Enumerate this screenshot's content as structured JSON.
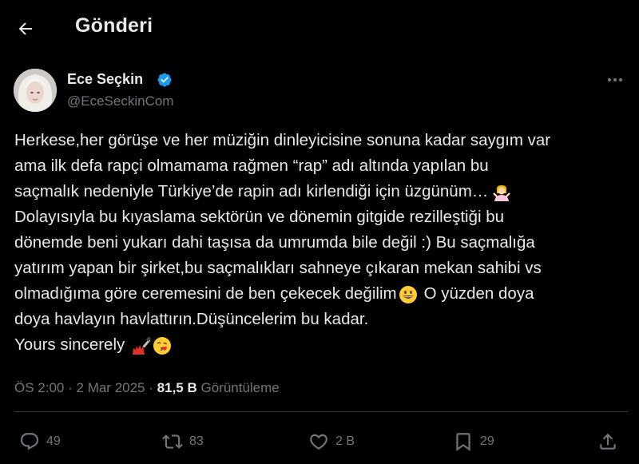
{
  "header": {
    "title": "Gönderi"
  },
  "author": {
    "name": "Ece Seçkin",
    "handle": "@EceSeckinCom"
  },
  "tweet": {
    "lines": [
      "Herkese,her görüşe ve her müziğin dinleyicisine sonuna kadar saygım var",
      "ama ilk defa rapçi olmamama rağmen “rap” adı altında yapılan bu",
      "saçmalık nedeniyle Türkiye’de rapin adı kirlendiği için üzgünüm…",
      "Dolayısıyla bu kıyaslama sektörün ve dönemin gitgide rezilleştiği bu",
      "dönemde beni yukarı dahi taşısa da umrumda bile değil :) Bu saçmalığa",
      "yatırım yapan bir şirket,bu saçmalıkları sahneye çıkaran mekan sahibi vs",
      "olmadığıma göre ceremesini de ben çekecek değilim",
      "O yüzden doya",
      "doya havlayın havlattırın.Düşüncelerim bu kadar.",
      "Yours sincerely"
    ]
  },
  "meta": {
    "time": "ÖS 2:00",
    "separator": "·",
    "date": "2 Mar 2025",
    "views_count": "81,5 B",
    "views_label": "Görüntüleme"
  },
  "actions": {
    "replies": "49",
    "reposts": "83",
    "likes": "2 B",
    "bookmarks": "29"
  },
  "colors": {
    "background": "#000000",
    "text": "#e7e9ea",
    "muted": "#71767b",
    "divider": "#2f3336",
    "verified": "#1d9bf0"
  },
  "icons": [
    "back-arrow-icon",
    "verified-badge-icon",
    "more-icon",
    "shrug-emoji-icon",
    "grinning-emoji-icon",
    "nail-polish-emoji-icon",
    "kiss-emoji-icon",
    "reply-icon",
    "repost-icon",
    "like-icon",
    "bookmark-icon",
    "share-icon"
  ]
}
